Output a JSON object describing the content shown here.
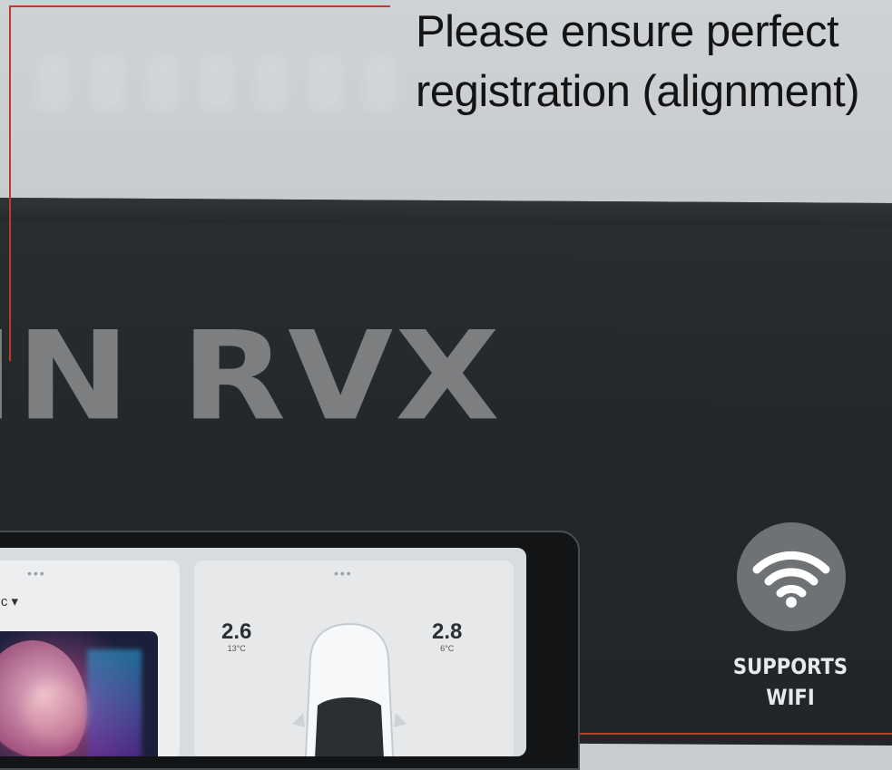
{
  "notice": {
    "line1": "Please ensure perfect",
    "line2": "registration (alignment)"
  },
  "brand": {
    "text": "IN RVX"
  },
  "device": {
    "music_label": "sic ▾",
    "tires": {
      "front_left": {
        "value": "2.6",
        "temp": "13°C"
      },
      "front_right": {
        "value": "2.8",
        "temp": "6°C"
      }
    }
  },
  "badge": {
    "icon": "wifi-icon",
    "line1": "SUPPORTS",
    "line2": "WIFI"
  },
  "colors": {
    "registration_line": "#c0392b",
    "dark_panel": "#24282a",
    "brand_text": "#7c7e80",
    "badge_circle": "#6f7274"
  }
}
